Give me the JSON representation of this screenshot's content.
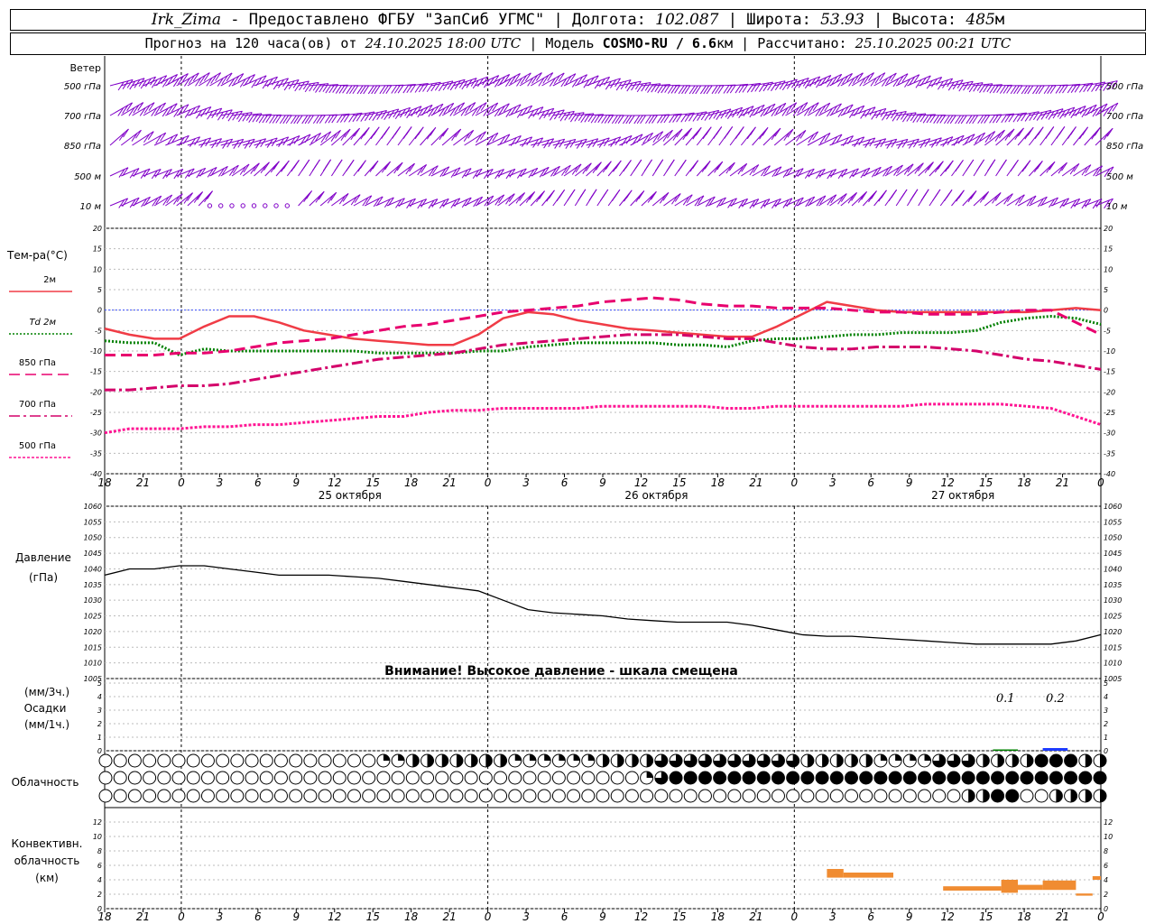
{
  "header": {
    "station": "Irk_Zima",
    "provider": "Предоставлено ФГБУ \"ЗапСиб УГМС\"",
    "lon_label": "Долгота:",
    "lon_value": "102.087",
    "lat_label": "Широта:",
    "lat_value": "53.93",
    "alt_label": "Высота:",
    "alt_value": "485",
    "alt_unit": "м",
    "forecast_prefix": "Прогноз на 120 часа(ов) от",
    "forecast_time": "24.10.2025 18:00 UTC",
    "model_label": "Модель",
    "model_name": "COSMO-RU / 6.6",
    "model_unit": "км",
    "calc_label": "Рассчитано:",
    "calc_time": "25.10.2025 00:21 UTC"
  },
  "labels": {
    "wind": "Ветер",
    "wind_levels": [
      "500 гПа",
      "700 гПа",
      "850 гПа",
      "500 м",
      "10  м"
    ],
    "temp_title": "Тем-ра(°C)",
    "legend_2m": "2м",
    "legend_td": "Td",
    "legend_td_suffix": "2м",
    "legend_850": "850 гПа",
    "legend_700": "700 гПа",
    "legend_500": "500 гПа",
    "pressure_title": "Давление",
    "pressure_unit": "(гПа)",
    "pressure_warning": "Внимание! Высокое давление - шкала смещена",
    "precip_unit_3h": "(мм/3ч.)",
    "precip_title": "Осадки",
    "precip_unit_1h": "(мм/1ч.)",
    "cloud_title": "Облачность",
    "conv_title_1": "Конвективн.",
    "conv_title_2": "облачность",
    "conv_unit": "(км)",
    "precip_value_labels": [
      "0.1",
      "0.2"
    ]
  },
  "axis": {
    "time_ticks": [
      "18",
      "21",
      "0",
      "3",
      "6",
      "9",
      "12",
      "15",
      "18",
      "21",
      "0",
      "3",
      "6",
      "9",
      "12",
      "15",
      "18",
      "21",
      "0",
      "3",
      "6",
      "9",
      "12",
      "15",
      "18",
      "21",
      "0"
    ],
    "day_labels": [
      "25 октября",
      "26 октября",
      "27 октября"
    ]
  },
  "colors": {
    "wind": "#8000c8",
    "t2m": "#f03c46",
    "td2m": "#008000",
    "t850": "#e8006e",
    "t700": "#d4006a",
    "t500": "#ff1493",
    "pressure": "#000000",
    "precip": "#1e3cff",
    "conv": "#f08c32"
  },
  "chart_data": [
    {
      "type": "line",
      "title": "Тем-ра(°C)",
      "x_hours": [
        0,
        3,
        6,
        9,
        12,
        15,
        18,
        21,
        24,
        27,
        30,
        33,
        36,
        39,
        42,
        45,
        48,
        51,
        54,
        57,
        60,
        63,
        66,
        69,
        72,
        75,
        78,
        81,
        84,
        87,
        90,
        93,
        96,
        99,
        102,
        105,
        108,
        111,
        114,
        117,
        120
      ],
      "ylim": [
        -40,
        20
      ],
      "yticks": [
        20,
        15,
        10,
        5,
        0,
        -5,
        -10,
        -15,
        -20,
        -25,
        -30,
        -35,
        -40
      ],
      "series": [
        {
          "name": "2м",
          "values": [
            -4.5,
            -6,
            -7,
            -7,
            -4,
            -1.5,
            -1.5,
            -3,
            -5,
            -6,
            -7,
            -7.5,
            -8,
            -8.5,
            -8.5,
            -6,
            -2,
            -0.5,
            -1,
            -2.5,
            -3.5,
            -4.5,
            -5,
            -5.5,
            -6,
            -6.5,
            -6.5,
            -4,
            -1,
            2,
            1,
            0,
            -0.5,
            -0.5,
            -0.5,
            -0.5,
            -0.5,
            -0.5,
            0,
            0.5,
            0
          ]
        },
        {
          "name": "Td 2м",
          "values": [
            -7.5,
            -8,
            -8,
            -11,
            -9.5,
            -10,
            -10,
            -10,
            -10,
            -10,
            -10,
            -10.5,
            -10.5,
            -10.5,
            -10.5,
            -10,
            -10,
            -9,
            -8.5,
            -8,
            -8,
            -8,
            -8,
            -8.5,
            -8.5,
            -9,
            -7.5,
            -7,
            -7,
            -6.5,
            -6,
            -6,
            -5.5,
            -5.5,
            -5.5,
            -5,
            -3,
            -2,
            -1.5,
            -2,
            -3.5
          ]
        },
        {
          "name": "850 гПа",
          "values": [
            -11,
            -11,
            -11,
            -10.5,
            -10.5,
            -10,
            -9,
            -8,
            -7.5,
            -7,
            -6,
            -5,
            -4,
            -3.5,
            -2.5,
            -1.5,
            -0.5,
            0,
            0.5,
            1,
            2,
            2.5,
            3,
            2.5,
            1.5,
            1,
            1,
            0.5,
            0.5,
            0.5,
            0,
            -0.5,
            -0.5,
            -1,
            -1,
            -1,
            -0.5,
            0,
            0,
            -3,
            -6
          ]
        },
        {
          "name": "700 гПа",
          "values": [
            -19.5,
            -19.5,
            -19,
            -18.5,
            -18.5,
            -18,
            -17,
            -16,
            -15,
            -14,
            -13,
            -12,
            -11.5,
            -11,
            -10.5,
            -9.5,
            -8.5,
            -8,
            -7.5,
            -7,
            -6.5,
            -6,
            -6,
            -6,
            -6.5,
            -7,
            -7,
            -8,
            -9,
            -9.5,
            -9.5,
            -9,
            -9,
            -9,
            -9.5,
            -10,
            -11,
            -12,
            -12.5,
            -13.5,
            -14.5
          ]
        },
        {
          "name": "500 гПа",
          "values": [
            -30,
            -29,
            -29,
            -29,
            -28.5,
            -28.5,
            -28,
            -28,
            -27.5,
            -27,
            -26.5,
            -26,
            -26,
            -25,
            -24.5,
            -24.5,
            -24,
            -24,
            -24,
            -24,
            -23.5,
            -23.5,
            -23.5,
            -23.5,
            -23.5,
            -24,
            -24,
            -23.5,
            -23.5,
            -23.5,
            -23.5,
            -23.5,
            -23.5,
            -23,
            -23,
            -23,
            -23,
            -23.5,
            -24,
            -26,
            -28
          ]
        }
      ]
    },
    {
      "type": "line",
      "title": "Давление",
      "ylabel": "(гПа)",
      "ylim": [
        1005,
        1060
      ],
      "yticks": [
        1060,
        1055,
        1050,
        1045,
        1040,
        1035,
        1030,
        1025,
        1020,
        1015,
        1010,
        1005
      ],
      "x_hours": [
        0,
        3,
        6,
        9,
        12,
        15,
        18,
        21,
        24,
        27,
        30,
        33,
        36,
        39,
        42,
        45,
        48,
        51,
        54,
        57,
        60,
        63,
        66,
        69,
        72,
        75,
        78,
        81,
        84,
        87,
        90,
        93,
        96,
        99,
        102,
        105,
        108,
        111,
        114,
        117,
        120
      ],
      "values": [
        1038,
        1040,
        1040,
        1041,
        1041,
        1040,
        1039,
        1038,
        1038,
        1038,
        1037.5,
        1037,
        1036,
        1035,
        1034,
        1033,
        1030,
        1027,
        1026,
        1025.5,
        1025,
        1024,
        1023.5,
        1023,
        1023,
        1023,
        1022,
        1020.5,
        1019,
        1018.5,
        1018.5,
        1018,
        1017.5,
        1017,
        1016.5,
        1016,
        1016,
        1016,
        1016,
        1017,
        1019
      ]
    },
    {
      "type": "bar",
      "title": "Осадки",
      "ylim": [
        0,
        5
      ],
      "yticks": [
        5,
        4,
        3,
        2,
        1,
        0
      ],
      "bars": [
        {
          "hour_start": 107,
          "hour_end": 110,
          "value": 0.1,
          "color": "#008000"
        },
        {
          "hour_start": 113,
          "hour_end": 116,
          "value": 0.2,
          "color": "#1e3cff"
        }
      ]
    },
    {
      "type": "table",
      "title": "Облачность",
      "note": "3 rows of cloud-cover circles (fraction 0..1) per hour",
      "rows": [
        {
          "name": "top",
          "segments": [
            [
              0,
              33,
              0
            ],
            [
              33,
              37,
              0.25
            ],
            [
              37,
              48,
              0.5
            ],
            [
              48,
              60,
              0.25
            ],
            [
              60,
              66,
              0.5
            ],
            [
              66,
              72,
              0.75
            ],
            [
              72,
              84,
              0.75
            ],
            [
              84,
              90,
              0.5
            ],
            [
              90,
              93,
              0.5
            ],
            [
              93,
              99,
              0.25
            ],
            [
              99,
              105,
              0.75
            ],
            [
              105,
              112,
              0.5
            ],
            [
              112,
              118,
              1
            ],
            [
              118,
              120,
              0.5
            ]
          ]
        },
        {
          "name": "middle",
          "segments": [
            [
              0,
              65,
              0
            ],
            [
              65,
              66,
              0.25
            ],
            [
              66,
              68,
              0.75
            ],
            [
              68,
              120,
              1
            ]
          ]
        },
        {
          "name": "bottom",
          "segments": [
            [
              0,
              104,
              0
            ],
            [
              104,
              107,
              0.5
            ],
            [
              107,
              111,
              1
            ],
            [
              111,
              114,
              0
            ],
            [
              114,
              120,
              0.5
            ]
          ]
        }
      ]
    },
    {
      "type": "bar",
      "title": "Конвективн. облачность",
      "ylabel": "(км)",
      "ylim": [
        0,
        14
      ],
      "yticks": [
        12,
        10,
        8,
        6,
        4,
        2,
        0
      ],
      "bars": [
        {
          "hour_start": 87,
          "hour_end": 89,
          "low": 4.3,
          "high": 5.5
        },
        {
          "hour_start": 89,
          "hour_end": 95,
          "low": 4.3,
          "high": 5.0
        },
        {
          "hour_start": 101,
          "hour_end": 108,
          "low": 2.5,
          "high": 3.1
        },
        {
          "hour_start": 108,
          "hour_end": 110,
          "low": 2.2,
          "high": 4.0
        },
        {
          "hour_start": 110,
          "hour_end": 113,
          "low": 2.6,
          "high": 3.3
        },
        {
          "hour_start": 113,
          "hour_end": 117,
          "low": 2.6,
          "high": 3.9
        },
        {
          "hour_start": 117,
          "hour_end": 119,
          "low": 1.8,
          "high": 2.1
        },
        {
          "hour_start": 119,
          "hour_end": 120,
          "low": 4.0,
          "high": 4.5
        }
      ]
    }
  ]
}
